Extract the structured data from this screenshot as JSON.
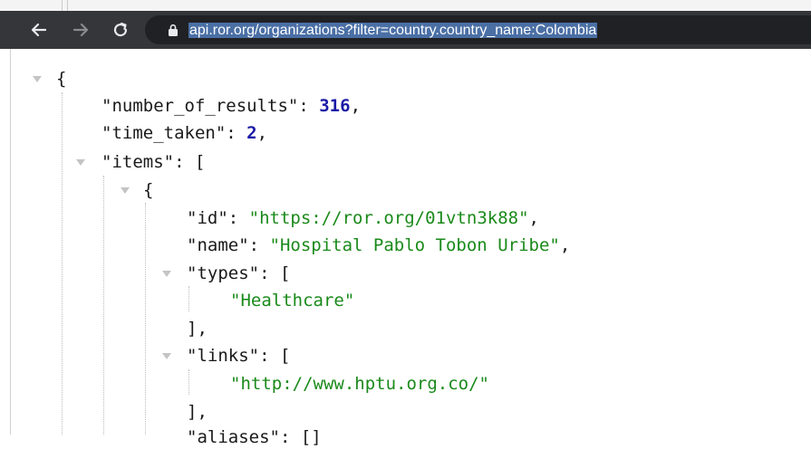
{
  "browser": {
    "url": "api.ror.org/organizations?filter=country.country_name:Colombia",
    "icons": [
      "back-arrow-icon",
      "forward-arrow-icon",
      "reload-icon",
      "lock-icon"
    ]
  },
  "json_view": {
    "open_brace": "{",
    "number_of_results_key": "\"number_of_results\"",
    "number_of_results_value": "316",
    "time_taken_key": "\"time_taken\"",
    "time_taken_value": "2",
    "items_key": "\"items\"",
    "items_open": "[",
    "item_open": "{",
    "id_key": "\"id\"",
    "id_value": "\"https://ror.org/01vtn3k88\"",
    "name_key": "\"name\"",
    "name_value": "\"Hospital Pablo Tobon Uribe\"",
    "types_key": "\"types\"",
    "types_value_0": "\"Healthcare\"",
    "links_key": "\"links\"",
    "links_value_0": "\"http://www.hptu.org.co/\"",
    "array_close": "],",
    "aliases_partial": "\"aliases\": []"
  },
  "colors": {
    "toolbar": "#35363a",
    "url_selection": "#4a6fa5",
    "number": "#1a1aa6",
    "string": "#1a8a1a"
  }
}
